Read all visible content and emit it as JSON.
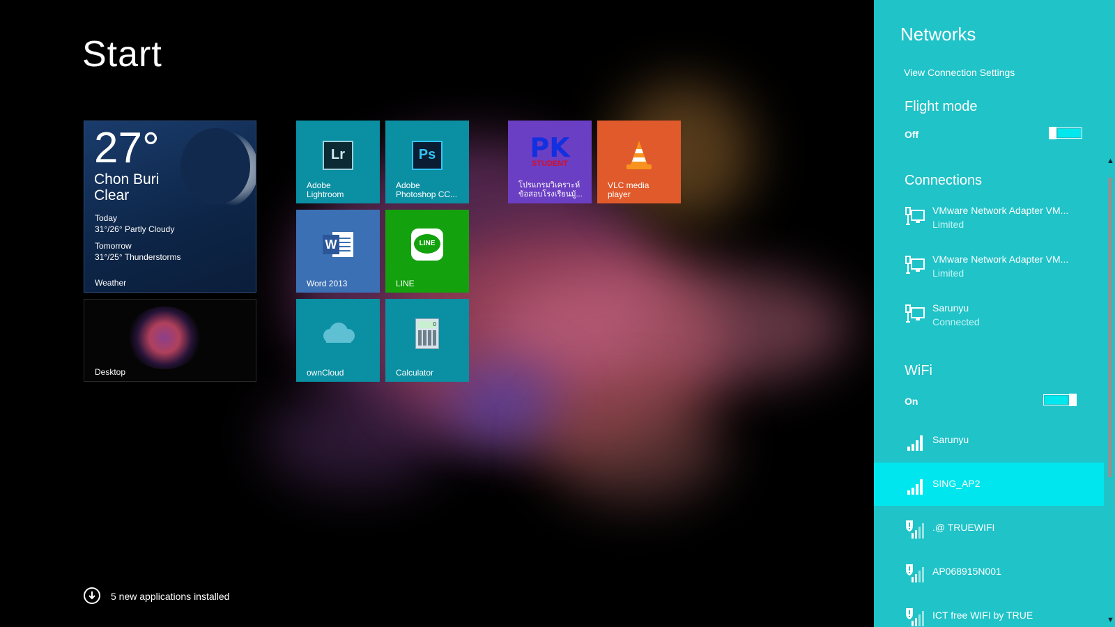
{
  "start": {
    "title": "Start"
  },
  "weather": {
    "temp": "27°",
    "city": "Chon Buri",
    "condition": "Clear",
    "today_label": "Today",
    "today_forecast": "31°/26° Partly Cloudy",
    "tomorrow_label": "Tomorrow",
    "tomorrow_forecast": "31°/25° Thunderstorms",
    "label": "Weather"
  },
  "desktop": {
    "label": "Desktop"
  },
  "tiles": {
    "lightroom": {
      "glyph": "Lr",
      "label_1": "Adobe",
      "label_2": "Lightroom"
    },
    "photoshop": {
      "glyph": "Ps",
      "label_1": "Adobe",
      "label_2": "Photoshop CC..."
    },
    "pk": {
      "glyph": "PK",
      "glyph_sub": "STUDENT",
      "label_1": "โปรแกรมวิเคราะห์",
      "label_2": "ข้อสอบโรงเรียนมู้..."
    },
    "vlc": {
      "label_1": "VLC media",
      "label_2": "player"
    },
    "word": {
      "glyph": "W",
      "label": "Word 2013"
    },
    "line": {
      "glyph": "LINE",
      "label": "LINE"
    },
    "owncloud": {
      "label": "ownCloud"
    },
    "calculator": {
      "glyph": "0",
      "label": "Calculator"
    }
  },
  "notification": {
    "text": "5 new applications installed"
  },
  "networks": {
    "title": "Networks",
    "view_settings": "View Connection Settings",
    "flight_mode": {
      "title": "Flight mode",
      "state": "Off"
    },
    "connections": {
      "title": "Connections",
      "items": [
        {
          "name": "VMware Network Adapter VM...",
          "status": "Limited"
        },
        {
          "name": "VMware Network Adapter VM...",
          "status": "Limited"
        },
        {
          "name": "Sarunyu",
          "status": "Connected"
        }
      ]
    },
    "wifi": {
      "title": "WiFi",
      "state": "On",
      "items": [
        {
          "name": "Sarunyu",
          "secured": false
        },
        {
          "name": "SING_AP2",
          "secured": false,
          "selected": true
        },
        {
          "name": ".@ TRUEWIFI",
          "secured": true
        },
        {
          "name": "AP068915N001",
          "secured": true
        },
        {
          "name": "ICT free WIFI by TRUE",
          "secured": true
        }
      ]
    }
  },
  "colors": {
    "pane": "#1fc3c8",
    "selected": "#00e6ee",
    "teal_tile": "#0a8fa3",
    "word_tile": "#3c70b4",
    "line_tile": "#13a10e",
    "pk_tile": "#6b3fc4",
    "vlc_tile": "#e05a2b"
  }
}
